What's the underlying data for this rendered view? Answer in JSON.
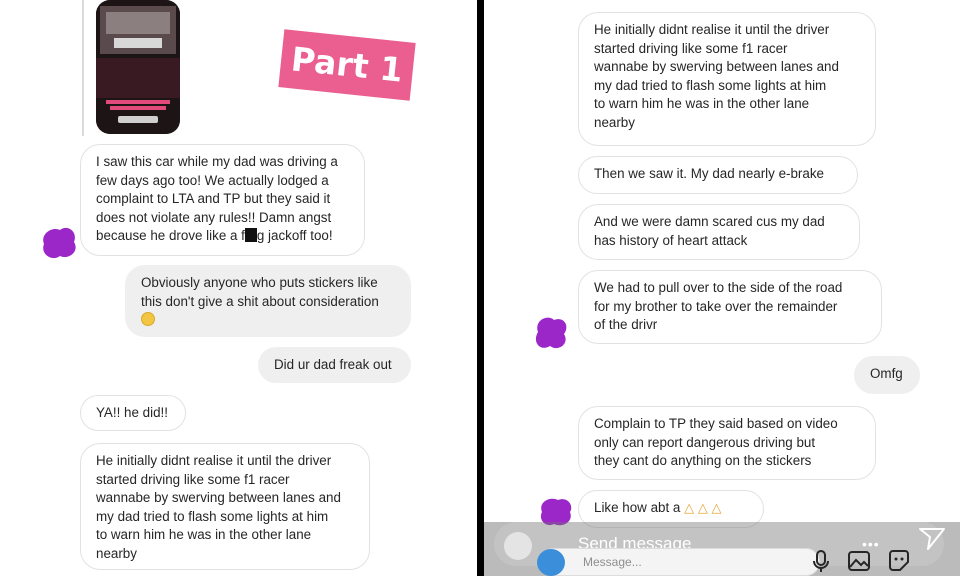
{
  "left_panel": {
    "stamp": "Part 1",
    "messages": [
      {
        "text_a": "I saw this car while my dad was driving a\nfew days ago too! We actually lodged a\ncomplaint to LTA and TP but they said it\ndoes not violate any rules!! Damn angst\nbecause he drove like a f",
        "text_b": "g jackoff too!"
      },
      {
        "text": "Obviously anyone who puts stickers like\nthis don't give a shit about consideration"
      },
      {
        "text": "Did ur dad freak out"
      },
      {
        "text": "YA!! he did!!"
      },
      {
        "text": "He initially didnt realise it until the driver\nstarted driving like some f1 racer\nwannabe by swerving between lanes and\nmy dad tried to flash some lights at him\nto warn him he was in the other lane\nnearby"
      }
    ]
  },
  "right_panel": {
    "messages": [
      {
        "text": "He initially didnt realise it until the driver\nstarted driving like some f1 racer\nwannabe by swerving between lanes and\nmy dad tried to flash some lights at him\nto warn him he was in the other lane\nnearby"
      },
      {
        "text": "Then we saw it. My dad nearly e-brake"
      },
      {
        "text": "And we were damn scared cus my dad\nhas history of heart attack"
      },
      {
        "text": "We had to pull over to the side of the road\nfor my brother to take over the remainder\nof the drivr"
      },
      {
        "text": "Omfg"
      },
      {
        "text": "Complain to TP they said based on video\nonly can report dangerous driving but\nthey cant do anything on the stickers"
      },
      {
        "text": "Like how abt a "
      }
    ],
    "reply": {
      "send_message": "Send message",
      "placeholder": "Message..."
    }
  },
  "colors": {
    "stamp": "#ea5f8f",
    "avatar_blot": "#9b27c9",
    "outgoing_bubble": "#efefef"
  },
  "icons": [
    "camera-icon",
    "mic-icon",
    "gallery-icon",
    "sticker-icon",
    "send-icon",
    "more-icon"
  ]
}
